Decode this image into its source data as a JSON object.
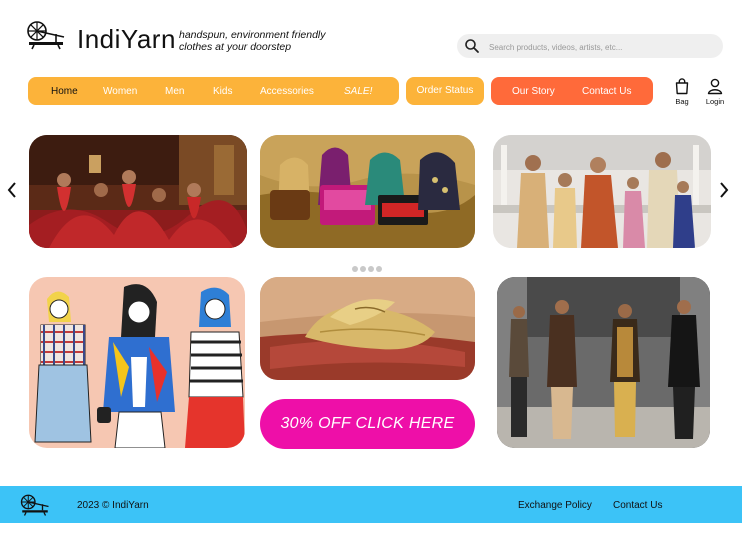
{
  "header": {
    "brand": "IndiYarn",
    "tagline_line1": "handspun, environment friendly",
    "tagline_line2": "clothes at your doorstep",
    "search_placeholder": "Search products, videos, artists, etc..."
  },
  "nav": {
    "items": [
      {
        "label": "Home"
      },
      {
        "label": "Women"
      },
      {
        "label": "Men"
      },
      {
        "label": "Kids"
      },
      {
        "label": "Accessories"
      },
      {
        "label": "SALE!"
      }
    ],
    "order_status": "Order Status",
    "our_story": "Our Story",
    "contact_us": "Contact Us",
    "bag": "Bag",
    "login": "Login"
  },
  "gallery": {
    "promo": "30% OFF CLICK HERE",
    "dot_count": 4
  },
  "footer": {
    "copyright": "2023 © IndiYarn",
    "exchange_policy": "Exchange Policy",
    "contact_us": "Contact Us"
  },
  "colors": {
    "nav_yellow": "#fcb33a",
    "nav_orange": "#ff6a3a",
    "promo_magenta": "#ee0fa8",
    "footer_blue": "#3cc3f7"
  }
}
